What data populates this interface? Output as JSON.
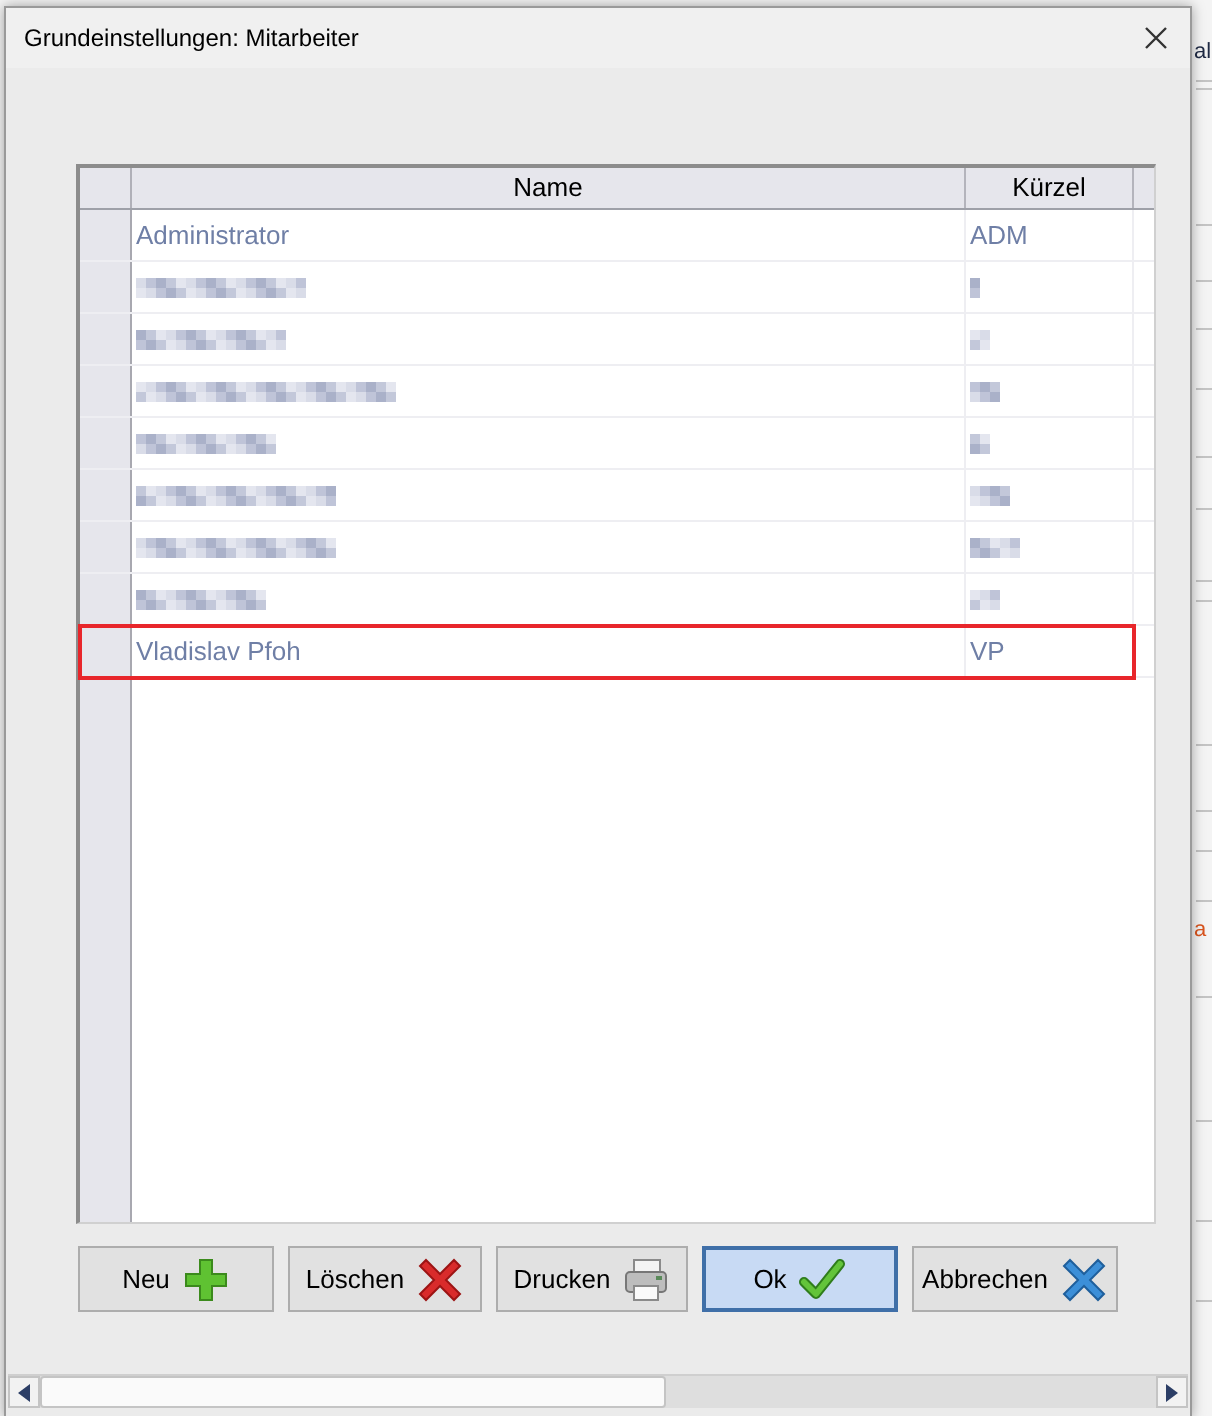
{
  "background_window": {
    "text_fragments": [
      {
        "text": "al",
        "color": "#1f2a44"
      },
      {
        "text": "a",
        "color": "#d9541e"
      }
    ]
  },
  "window": {
    "title": "Grundeinstellungen: Mitarbeiter"
  },
  "table": {
    "columns": [
      "Name",
      "Kürzel"
    ],
    "rows": [
      {
        "kind": "entry",
        "cells": [
          "Administrator",
          "ADM"
        ],
        "highlighted": false
      },
      {
        "kind": "redacted",
        "highlighted": false
      },
      {
        "kind": "redacted",
        "highlighted": false
      },
      {
        "kind": "redacted",
        "highlighted": false
      },
      {
        "kind": "redacted",
        "highlighted": false
      },
      {
        "kind": "redacted",
        "highlighted": false
      },
      {
        "kind": "redacted",
        "highlighted": false
      },
      {
        "kind": "redacted",
        "highlighted": false
      },
      {
        "kind": "entry",
        "cells": [
          "Vladislav Pfoh",
          "VP"
        ],
        "highlighted": true
      }
    ]
  },
  "buttons": [
    {
      "label": "Neu",
      "kind": "add",
      "default": false
    },
    {
      "label": "Löschen",
      "kind": "delete",
      "default": false
    },
    {
      "label": "Drucken",
      "kind": "print",
      "default": false
    },
    {
      "label": "Ok",
      "kind": "confirm",
      "default": true
    },
    {
      "label": "Abbrechen",
      "kind": "cancel",
      "default": false
    }
  ]
}
